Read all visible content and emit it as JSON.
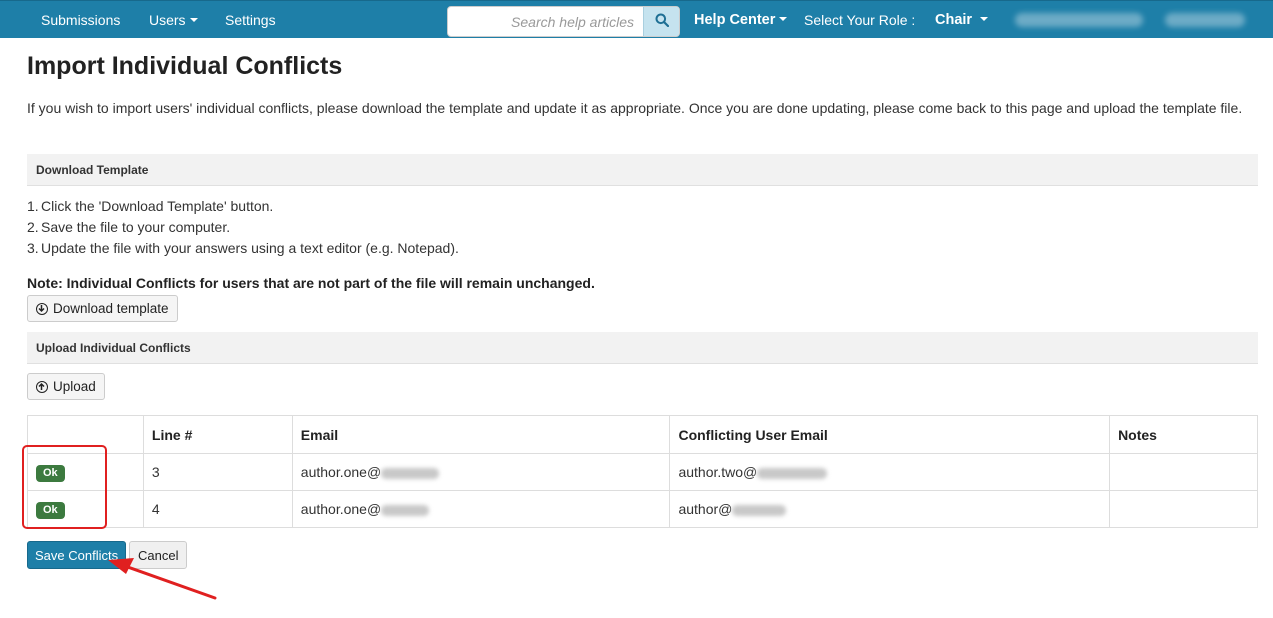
{
  "nav": {
    "submissions": "Submissions",
    "users": "Users",
    "settings": "Settings",
    "search_placeholder": "Search help articles",
    "help_center": "Help Center",
    "select_role_label": "Select Your Role :",
    "role": "Chair"
  },
  "page": {
    "title": "Import Individual Conflicts",
    "intro": "If you wish to import users' individual conflicts, please download the template and update it as appropriate. Once you are done updating, please come back to this page and upload the template file."
  },
  "download_section": {
    "header": "Download Template",
    "steps": [
      {
        "num": "1.",
        "text": "Click the 'Download Template' button."
      },
      {
        "num": "2.",
        "text": "Save the file to your computer."
      },
      {
        "num": "3.",
        "text": "Update the file with your answers using a text editor (e.g. Notepad)."
      }
    ],
    "note": "Note: Individual Conflicts for users that are not part of the file will remain unchanged.",
    "button": "Download template"
  },
  "upload_section": {
    "header": "Upload Individual Conflicts",
    "button": "Upload"
  },
  "table": {
    "columns": [
      "",
      "Line #",
      "Email",
      "Conflicting User Email",
      "Notes"
    ],
    "rows": [
      {
        "status": "Ok",
        "line": "3",
        "email": "author.one@",
        "conflicting_email": "author.two@",
        "notes": ""
      },
      {
        "status": "Ok",
        "line": "4",
        "email": "author.one@",
        "conflicting_email": "author@",
        "notes": ""
      }
    ]
  },
  "actions": {
    "save": "Save Conflicts",
    "cancel": "Cancel"
  },
  "colors": {
    "navbar": "#1e7fa8",
    "ok_badge": "#3c7a3f",
    "annotation": "#e02020"
  }
}
